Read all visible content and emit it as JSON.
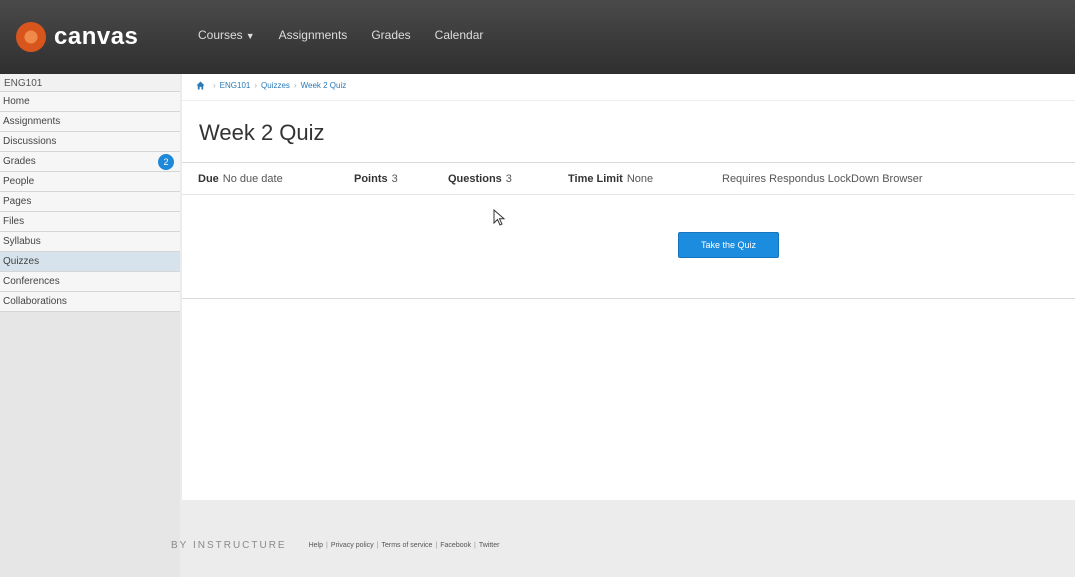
{
  "header": {
    "brand": "canvas",
    "nav": [
      {
        "label": "Courses",
        "has_dropdown": true
      },
      {
        "label": "Assignments",
        "has_dropdown": false
      },
      {
        "label": "Grades",
        "has_dropdown": false
      },
      {
        "label": "Calendar",
        "has_dropdown": false
      }
    ]
  },
  "sidebar": {
    "course_code": "ENG101",
    "items": [
      {
        "label": "Home"
      },
      {
        "label": "Assignments"
      },
      {
        "label": "Discussions"
      },
      {
        "label": "Grades",
        "badge": "2"
      },
      {
        "label": "People"
      },
      {
        "label": "Pages"
      },
      {
        "label": "Files"
      },
      {
        "label": "Syllabus"
      },
      {
        "label": "Quizzes",
        "active": true
      },
      {
        "label": "Conferences"
      },
      {
        "label": "Collaborations"
      }
    ]
  },
  "breadcrumb": {
    "items": [
      "ENG101",
      "Quizzes",
      "Week 2 Quiz"
    ]
  },
  "quiz": {
    "title": "Week 2 Quiz",
    "due_label": "Due",
    "due_value": "No due date",
    "points_label": "Points",
    "points_value": "3",
    "questions_label": "Questions",
    "questions_value": "3",
    "time_limit_label": "Time Limit",
    "time_limit_value": "None",
    "lockdown_text": "Requires Respondus LockDown Browser",
    "take_button": "Take the Quiz"
  },
  "footer": {
    "brand": "BY INSTRUCTURE",
    "links": [
      "Help",
      "Privacy policy",
      "Terms of service",
      "Facebook",
      "Twitter"
    ]
  },
  "colors": {
    "accent": "#1c8cdf",
    "header_bg": "#3a3a3a",
    "logo": "#d8561e",
    "link": "#2a7ab8"
  }
}
